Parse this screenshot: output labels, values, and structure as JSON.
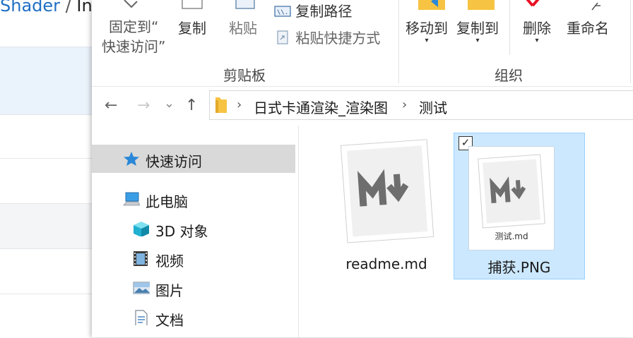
{
  "background_window": {
    "title_primary": "Shader",
    "title_separator": "/",
    "title_rest": "In"
  },
  "ribbon": {
    "pin_label_line1": "固定到“",
    "pin_label_line2": "快速访问”",
    "copy_label": "复制",
    "paste_label": "粘贴",
    "copy_path_label": "复制路径",
    "paste_shortcut_label": "粘贴快捷方式",
    "clipboard_group": "剪贴板",
    "move_to_label": "移动到",
    "copy_to_label": "复制到",
    "delete_label": "删除",
    "rename_label": "重命名",
    "organize_group": "组织",
    "dropdown_arrow": "▾",
    "accent_colors": {
      "delete_red": "#e81123",
      "folder_yellow": "#f6c342",
      "move_blue": "#2b88d8"
    }
  },
  "address_bar": {
    "back": "←",
    "forward": "→",
    "recent": "⌄",
    "up": "↑",
    "crumb_separator": "›",
    "crumbs": [
      "日式卡通渲染_渲染图",
      "测试"
    ]
  },
  "nav_pane": {
    "items": [
      {
        "label": "快速访问",
        "icon": "star-icon",
        "selected": true
      },
      {
        "label": "此电脑",
        "icon": "computer-icon",
        "selected": false
      },
      {
        "label": "3D 对象",
        "icon": "cube-3d-icon",
        "selected": false
      },
      {
        "label": "视频",
        "icon": "video-icon",
        "selected": false
      },
      {
        "label": "图片",
        "icon": "pictures-icon",
        "selected": false
      },
      {
        "label": "文档",
        "icon": "documents-icon",
        "selected": false
      }
    ]
  },
  "files": [
    {
      "name": "readme.md",
      "icon": "markdown-file-icon",
      "selected": false
    },
    {
      "name": "捕获.PNG",
      "icon": "image-thumbnail-icon",
      "selected": true,
      "checked": true,
      "checkmark": "✓",
      "thumbnail_caption": "测试.md"
    }
  ]
}
